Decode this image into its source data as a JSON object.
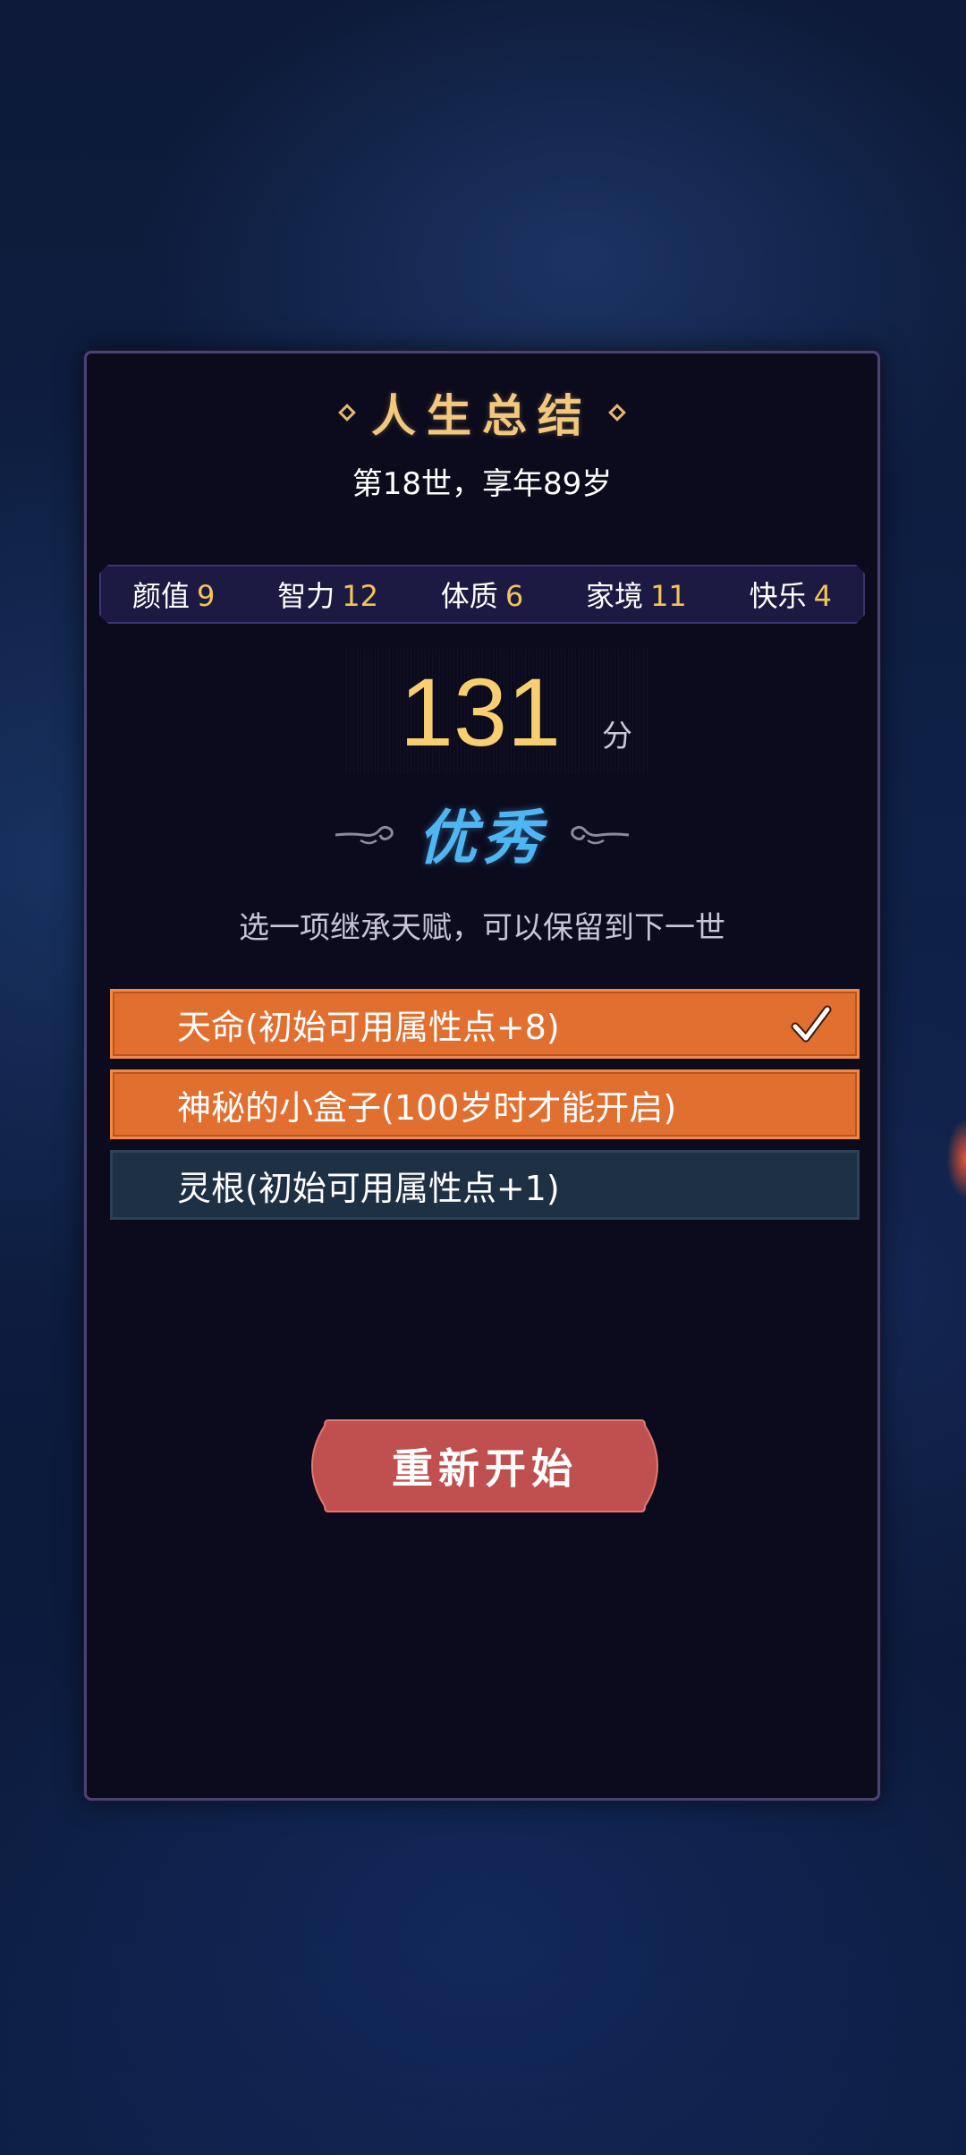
{
  "summary": {
    "title": "人生总结",
    "subtitle": "第18世，享年89岁"
  },
  "stats": [
    {
      "label": "颜值",
      "value": "9"
    },
    {
      "label": "智力",
      "value": "12"
    },
    {
      "label": "体质",
      "value": "6"
    },
    {
      "label": "家境",
      "value": "11"
    },
    {
      "label": "快乐",
      "value": "4"
    }
  ],
  "score": {
    "value": "131",
    "unit": "分",
    "grade": "优秀"
  },
  "inherit": {
    "hint": "选一项继承天赋，可以保留到下一世",
    "options": [
      {
        "label": "天命(初始可用属性点+8)",
        "selected": true
      },
      {
        "label": "神秘的小盒子(100岁时才能开启)",
        "selected": false
      },
      {
        "label": "灵根(初始可用属性点+1)",
        "selected": false
      }
    ]
  },
  "actions": {
    "restart_label": "重新开始"
  },
  "colors": {
    "accent_gold": "#f1c87e",
    "grade_blue": "#4fb6f2",
    "option_orange": "#e06f30",
    "option_dark": "#1e3044",
    "restart_red": "#c0504f"
  }
}
